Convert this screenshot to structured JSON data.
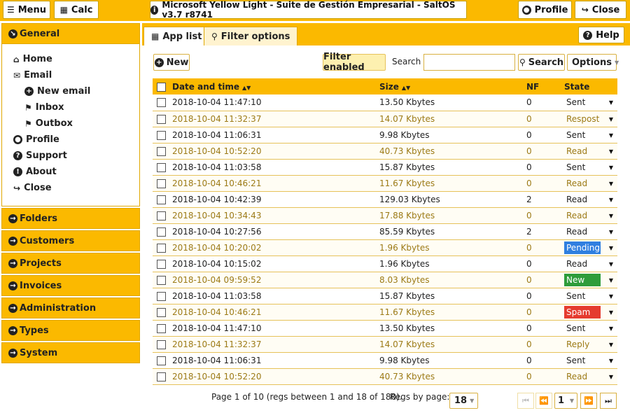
{
  "topbar": {
    "menu_label": "Menu",
    "calc_label": "Calc",
    "title": "Microsoft Yellow Light - Suite de Gestión Empresarial - SaltOS v3.7 r8741",
    "profile_label": "Profile",
    "close_label": "Close"
  },
  "sidebar": {
    "general_label": "General",
    "items": [
      {
        "label": "Home",
        "icon": "home-icon"
      },
      {
        "label": "Email",
        "icon": "envelope-icon"
      },
      {
        "label": "New email",
        "icon": "plus-circle-icon"
      },
      {
        "label": "Inbox",
        "icon": "tag-icon"
      },
      {
        "label": "Outbox",
        "icon": "tag-icon"
      },
      {
        "label": "Profile",
        "icon": "user-circle-icon"
      },
      {
        "label": "Support",
        "icon": "question-circle-icon"
      },
      {
        "label": "About",
        "icon": "info-circle-icon"
      },
      {
        "label": "Close",
        "icon": "sign-out-icon"
      }
    ],
    "groups": [
      "Folders",
      "Customers",
      "Projects",
      "Invoices",
      "Administration",
      "Types",
      "System"
    ]
  },
  "tabs": {
    "app_list": "App list",
    "filter_options": "Filter options",
    "help": "Help"
  },
  "toolbar": {
    "new_label": "New",
    "filter_status": "Filter enabled",
    "search_label": "Search",
    "search_value": "",
    "search_button": "Search",
    "options_label": "Options"
  },
  "table": {
    "columns": [
      "Date and time",
      "Size",
      "NF",
      "State"
    ],
    "rows": [
      {
        "date": "2018-10-04 11:47:10",
        "size": "13.50 Kbytes",
        "nf": "0",
        "state": "Sent"
      },
      {
        "date": "2018-10-04 11:32:37",
        "size": "14.07 Kbytes",
        "nf": "0",
        "state": "Respost"
      },
      {
        "date": "2018-10-04 11:06:31",
        "size": "9.98 Kbytes",
        "nf": "0",
        "state": "Sent"
      },
      {
        "date": "2018-10-04 10:52:20",
        "size": "40.73 Kbytes",
        "nf": "0",
        "state": "Read"
      },
      {
        "date": "2018-10-04 11:03:58",
        "size": "15.87 Kbytes",
        "nf": "0",
        "state": "Sent"
      },
      {
        "date": "2018-10-04 10:46:21",
        "size": "11.67 Kbytes",
        "nf": "0",
        "state": "Read"
      },
      {
        "date": "2018-10-04 10:42:39",
        "size": "129.03 Kbytes",
        "nf": "2",
        "state": "Read"
      },
      {
        "date": "2018-10-04 10:34:43",
        "size": "17.88 Kbytes",
        "nf": "0",
        "state": "Read"
      },
      {
        "date": "2018-10-04 10:27:56",
        "size": "85.59 Kbytes",
        "nf": "2",
        "state": "Read"
      },
      {
        "date": "2018-10-04 10:20:02",
        "size": "1.96 Kbytes",
        "nf": "0",
        "state": "Pending"
      },
      {
        "date": "2018-10-04 10:15:02",
        "size": "1.96 Kbytes",
        "nf": "0",
        "state": "Read"
      },
      {
        "date": "2018-10-04 09:59:52",
        "size": "8.03 Kbytes",
        "nf": "0",
        "state": "New"
      },
      {
        "date": "2018-10-04 11:03:58",
        "size": "15.87 Kbytes",
        "nf": "0",
        "state": "Sent"
      },
      {
        "date": "2018-10-04 10:46:21",
        "size": "11.67 Kbytes",
        "nf": "0",
        "state": "Spam"
      },
      {
        "date": "2018-10-04 11:47:10",
        "size": "13.50 Kbytes",
        "nf": "0",
        "state": "Sent"
      },
      {
        "date": "2018-10-04 11:32:37",
        "size": "14.07 Kbytes",
        "nf": "0",
        "state": "Reply"
      },
      {
        "date": "2018-10-04 11:06:31",
        "size": "9.98 Kbytes",
        "nf": "0",
        "state": "Sent"
      },
      {
        "date": "2018-10-04 10:52:20",
        "size": "40.73 Kbytes",
        "nf": "0",
        "state": "Read"
      }
    ]
  },
  "pager": {
    "info": "Page 1 of 10 (regs between 1 and 18 of 180).",
    "regs_label": "Regs by page:",
    "regs_value": "18",
    "page_value": "1"
  },
  "colors": {
    "accent": "#fbb900",
    "pending": "#2f7fe0",
    "new": "#2e9c3a",
    "spam": "#e53b2f"
  }
}
